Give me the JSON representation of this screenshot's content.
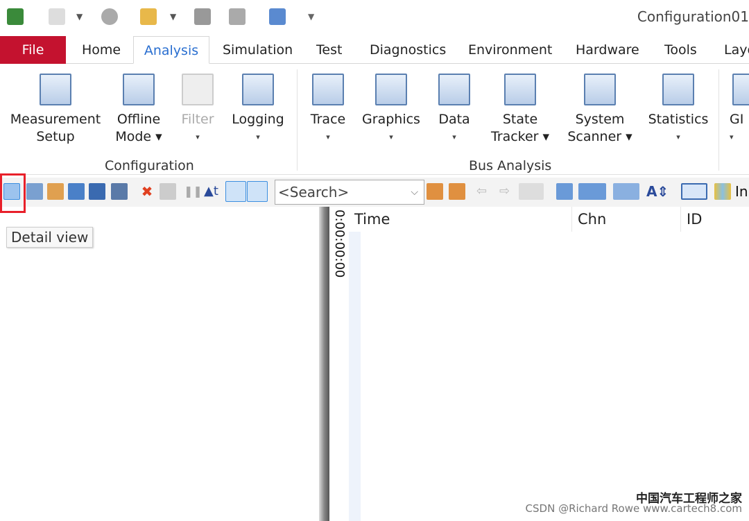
{
  "app": {
    "title": "Configuration01"
  },
  "qat": {
    "icons": [
      "app-logo-icon",
      "lightning-icon",
      "stop-icon",
      "open-folder-icon",
      "save-icon",
      "save-as-icon",
      "network-config-icon",
      "customize-icon"
    ]
  },
  "tabs": [
    {
      "label": "File"
    },
    {
      "label": "Home"
    },
    {
      "label": "Analysis",
      "active": true
    },
    {
      "label": "Simulation"
    },
    {
      "label": "Test"
    },
    {
      "label": "Diagnostics"
    },
    {
      "label": "Environment"
    },
    {
      "label": "Hardware"
    },
    {
      "label": "Tools"
    },
    {
      "label": "Layout"
    }
  ],
  "ribbon": {
    "groups": [
      {
        "label": "Configuration"
      },
      {
        "label": "Bus Analysis"
      }
    ],
    "buttons": [
      {
        "l1": "Measurement",
        "l2": "Setup"
      },
      {
        "l1": "Offline",
        "l2": "Mode ▾"
      },
      {
        "l1": "Filter",
        "l2": "▾",
        "disabled": true
      },
      {
        "l1": "Logging",
        "l2": "▾"
      },
      {
        "l1": "Trace",
        "l2": "▾"
      },
      {
        "l1": "Graphics",
        "l2": "▾"
      },
      {
        "l1": "Data",
        "l2": "▾"
      },
      {
        "l1": "State",
        "l2": "Tracker ▾"
      },
      {
        "l1": "System",
        "l2": "Scanner ▾"
      },
      {
        "l1": "Statistics",
        "l2": "▾"
      },
      {
        "l1": "GI",
        "l2": "▾"
      }
    ]
  },
  "toolbar": {
    "search_placeholder": "<Search>",
    "trailing_label": "In"
  },
  "tooltip": "Detail view",
  "trace": {
    "time_value": "0:00:00:00",
    "columns": [
      "Time",
      "Chn",
      "ID"
    ]
  },
  "watermark": {
    "line1": "中国汽车工程师之家",
    "line2": "CSDN @Richard Rowe  www.cartech8.com"
  },
  "colors": {
    "file_tab": "#c4122f",
    "active_tab": "#2a6fd0",
    "highlight": "#e8202a"
  }
}
